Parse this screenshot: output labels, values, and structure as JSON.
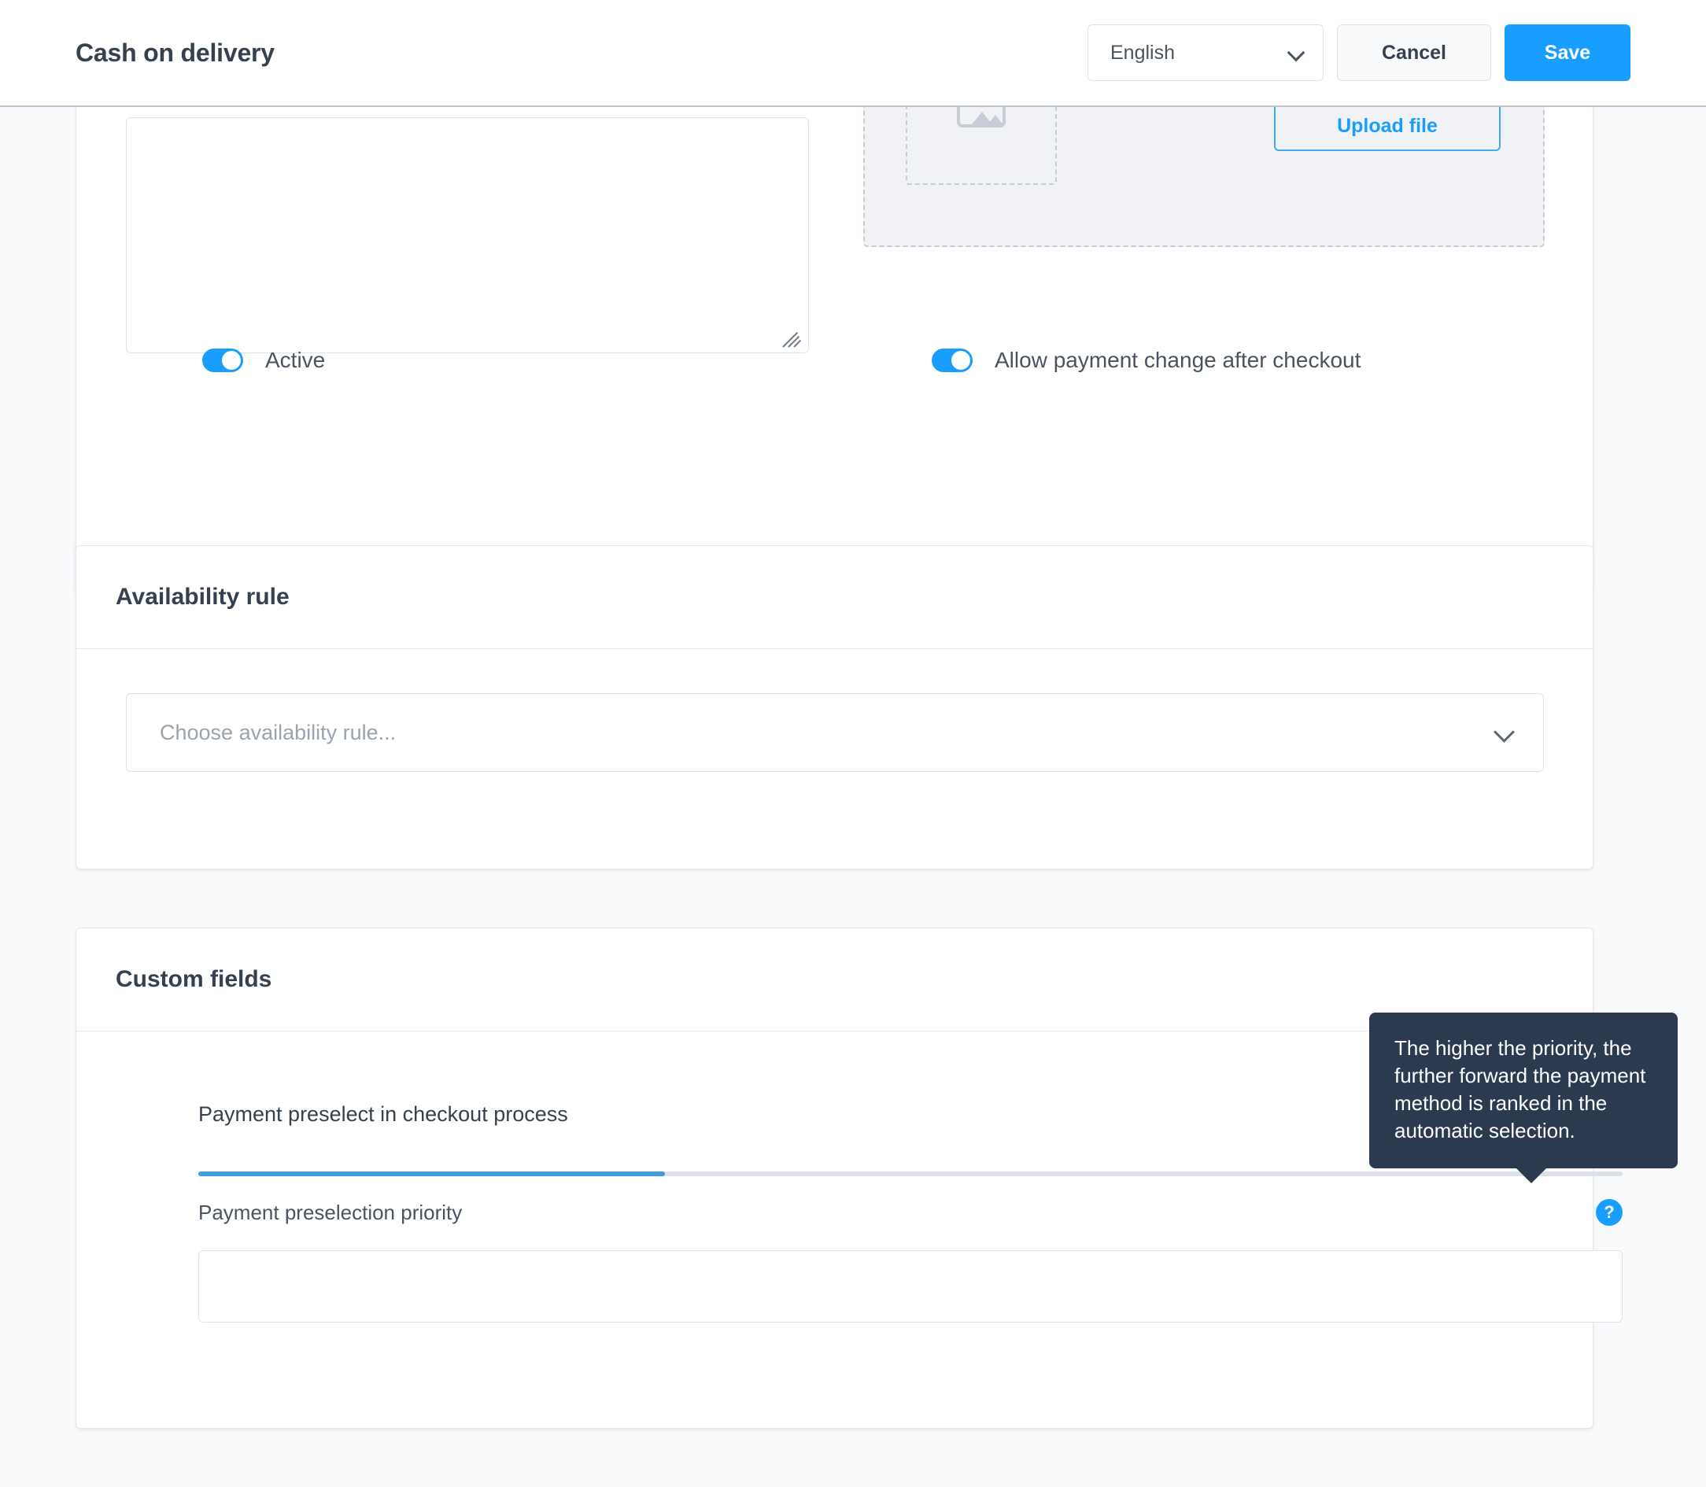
{
  "header": {
    "title": "Cash on delivery",
    "language_value": "English",
    "cancel_label": "Cancel",
    "save_label": "Save"
  },
  "general_card": {
    "description_value": "",
    "upload_file_label": "Upload file",
    "toggles": [
      {
        "label": "Active",
        "on": true
      },
      {
        "label": "Allow payment change after checkout",
        "on": true
      }
    ]
  },
  "availability_card": {
    "title": "Availability rule",
    "select_placeholder": "Choose availability rule...",
    "select_value": ""
  },
  "custom_fields_card": {
    "title": "Custom fields",
    "tab_label": "Payment preselect in checkout process",
    "priority_label": "Payment preselection priority",
    "priority_value": "",
    "help_icon_glyph": "?"
  },
  "tooltip": {
    "text": "The higher the priority, the further forward the payment method is ranked in the automatic selection."
  },
  "colors": {
    "accent": "#189eff",
    "tab_active": "#3a9fe0",
    "tooltip_bg": "#2b3a4f",
    "page_bg": "#f9fafb",
    "text": "#35414f"
  }
}
